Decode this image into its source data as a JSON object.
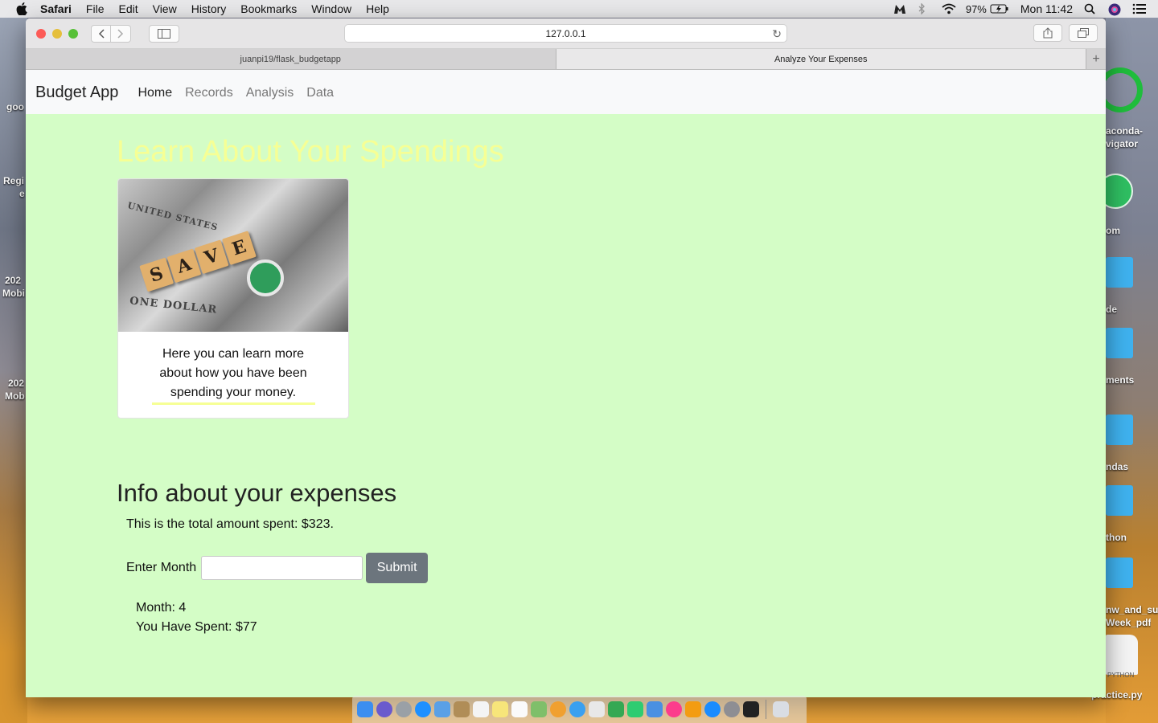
{
  "menubar": {
    "app_name": "Safari",
    "items": [
      "File",
      "Edit",
      "View",
      "History",
      "Bookmarks",
      "Window",
      "Help"
    ],
    "battery": "97%",
    "clock": "Mon 11:42"
  },
  "desktop": {
    "left_labels": [
      "goo",
      "Regi",
      "e",
      "202",
      "Mobi",
      "202",
      "Mob"
    ],
    "right_labels": [
      "aconda-",
      "vigator",
      "om",
      "de",
      "ments",
      "ndas",
      "thon",
      "nw_and_su",
      "Week_pdf",
      "practice.py"
    ],
    "doc_badge": "PYTHON",
    "dock_partial_label": "..."
  },
  "browser": {
    "address": "127.0.0.1",
    "tabs": [
      "juanpi19/flask_budgetapp",
      "Analyze Your Expenses"
    ],
    "new_tab": "+"
  },
  "navbar": {
    "brand": "Budget App",
    "links": [
      "Home",
      "Records",
      "Analysis",
      "Data"
    ]
  },
  "hero": {
    "title": "Learn About Your Spendings",
    "image_tiles": [
      "S",
      "A",
      "V",
      "E"
    ],
    "image_bill_text_1": "UNITED STATES",
    "image_bill_text_2": "ONE DOLLAR",
    "card_text": "Here you can learn more about how you have been spending your money."
  },
  "expenses": {
    "title": "Info about your expenses",
    "total": "This is the total amount spent: $323.",
    "input_label": "Enter Month",
    "input_value": "",
    "submit_label": "Submit",
    "result_month": "Month: 4",
    "result_spent": "You Have Spent: $77"
  },
  "colors": {
    "page_background": "#d4fdc6",
    "hero_title": "#f6ff95",
    "submit_button": "#6c757d"
  }
}
